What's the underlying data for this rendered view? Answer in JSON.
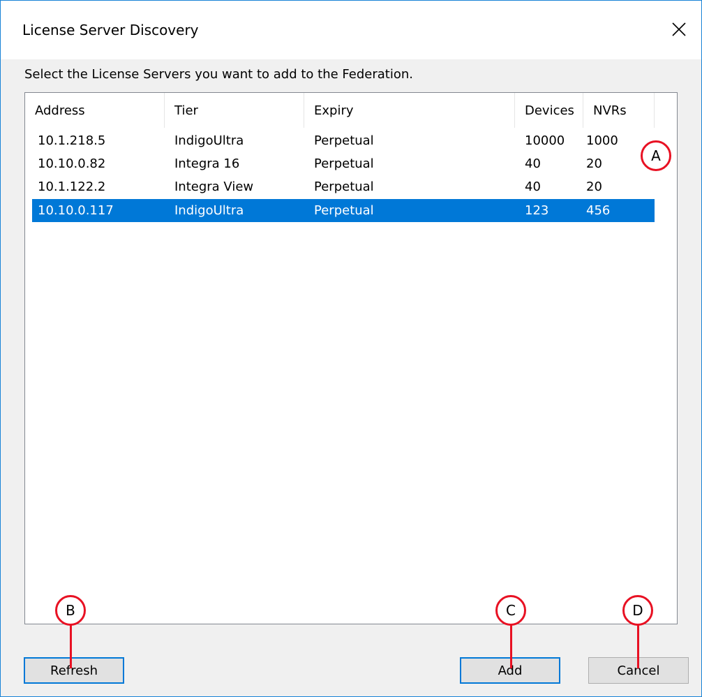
{
  "window": {
    "title": "License Server Discovery"
  },
  "instruction": "Select the License Servers you want to add to the Federation.",
  "list": {
    "columns": [
      "Address",
      "Tier",
      "Expiry",
      "Devices",
      "NVRs"
    ],
    "rows": [
      {
        "address": "10.1.218.5",
        "tier": "IndigoUltra",
        "expiry": "Perpetual",
        "devices": "10000",
        "nvrs": "1000",
        "selected": false
      },
      {
        "address": "10.10.0.82",
        "tier": "Integra 16",
        "expiry": "Perpetual",
        "devices": "40",
        "nvrs": "20",
        "selected": false
      },
      {
        "address": "10.1.122.2",
        "tier": "Integra View",
        "expiry": "Perpetual",
        "devices": "40",
        "nvrs": "20",
        "selected": false
      },
      {
        "address": "10.10.0.117",
        "tier": "IndigoUltra",
        "expiry": "Perpetual",
        "devices": "123",
        "nvrs": "456",
        "selected": true
      }
    ]
  },
  "buttons": {
    "refresh": "Refresh",
    "add": "Add",
    "cancel": "Cancel"
  },
  "callouts": {
    "a": "A",
    "b": "B",
    "c": "C",
    "d": "D"
  },
  "colors": {
    "selection": "#0078d7",
    "callout": "#e81123",
    "window_border": "#1883d7"
  },
  "icons": {
    "close": "close-icon"
  }
}
